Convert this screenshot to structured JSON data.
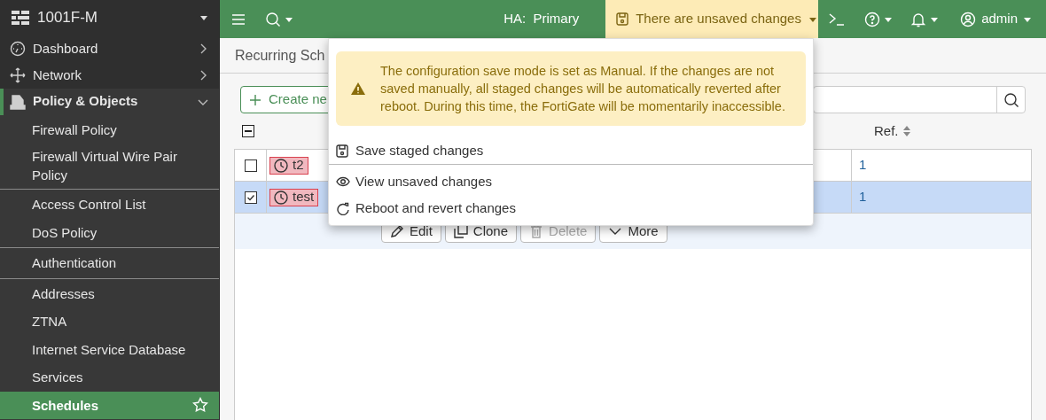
{
  "sidebar": {
    "device": {
      "label": "1001F-M"
    },
    "items": [
      {
        "label": "Dashboard",
        "expanded": false
      },
      {
        "label": "Network",
        "expanded": false
      },
      {
        "label": "Policy & Objects",
        "expanded": true,
        "children_groups": [
          {
            "items": [
              {
                "label": "Firewall Policy",
                "selected": false
              },
              {
                "label": "Firewall Virtual Wire Pair Policy",
                "selected": false
              }
            ]
          },
          {
            "items": [
              {
                "label": "Access Control List",
                "selected": false
              },
              {
                "label": "DoS Policy",
                "selected": false
              }
            ]
          },
          {
            "items": [
              {
                "label": "Authentication",
                "selected": false
              }
            ]
          },
          {
            "items": [
              {
                "label": "Addresses",
                "selected": false
              },
              {
                "label": "ZTNA",
                "selected": false
              },
              {
                "label": "Internet Service Database",
                "selected": false
              },
              {
                "label": "Services",
                "selected": false
              },
              {
                "label": "Schedules",
                "selected": true
              }
            ]
          }
        ]
      }
    ]
  },
  "header": {
    "ha_status": "HA:  Primary",
    "unsaved_button": "There are unsaved changes",
    "user": "admin"
  },
  "page": {
    "title": "Recurring Sch",
    "create_button": "Create ne",
    "table": {
      "columns": [
        {
          "label": "Ref."
        }
      ],
      "header_checkbox_indeterminate": true,
      "rows": [
        {
          "name": "t2",
          "ref": "1",
          "checked": false,
          "selected": false
        },
        {
          "name": "test",
          "ref": "1",
          "checked": true,
          "selected": true
        }
      ],
      "row_actions": [
        {
          "label": "Edit",
          "disabled": false
        },
        {
          "label": "Clone",
          "disabled": false
        },
        {
          "label": "Delete",
          "disabled": true
        },
        {
          "label": "More",
          "disabled": false
        }
      ]
    }
  },
  "dropdown": {
    "warning": "The configuration save mode is set as Manual. If the changes are not saved manually, all staged changes will be automatically reverted after reboot. During this time, the FortiGate will be momentarily inaccessible.",
    "items": [
      {
        "label": "Save staged changes",
        "divider_after": true
      },
      {
        "label": "View unsaved changes",
        "divider_after": false
      },
      {
        "label": "Reboot and revert changes",
        "divider_after": false
      }
    ]
  }
}
